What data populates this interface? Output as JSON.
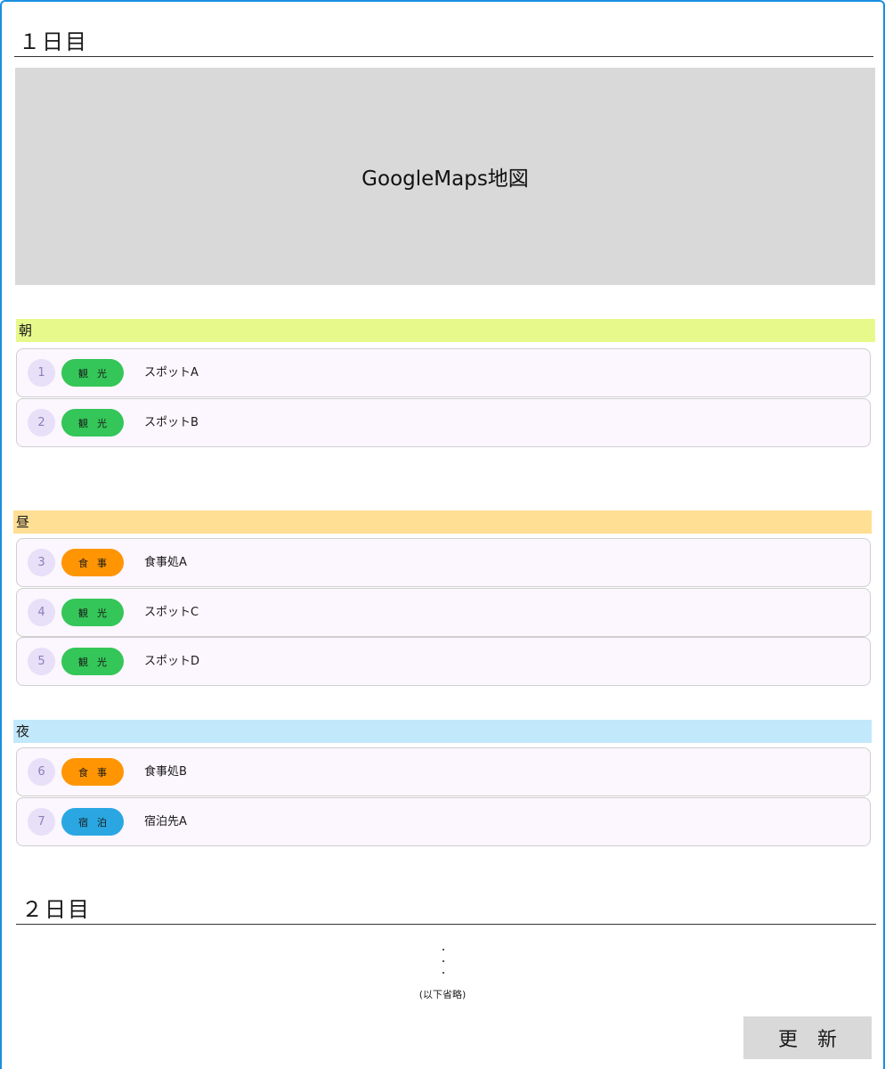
{
  "day1": {
    "title": "１日目"
  },
  "map": {
    "label": "GoogleMaps地図"
  },
  "periods": {
    "morning": {
      "label": "朝",
      "color": "#e8f98c"
    },
    "noon": {
      "label": "昼",
      "color": "#ffdf94"
    },
    "night": {
      "label": "夜",
      "color": "#c2e8fb"
    }
  },
  "categories": {
    "sightseeing": {
      "label": "観光",
      "color": "#34c658"
    },
    "meal": {
      "label": "食事",
      "color": "#ff9502"
    },
    "lodging": {
      "label": "宿泊",
      "color": "#2aa7e2"
    }
  },
  "items": [
    {
      "num": "1",
      "category": "観光",
      "name": "スポットA"
    },
    {
      "num": "2",
      "category": "観光",
      "name": "スポットB"
    },
    {
      "num": "3",
      "category": "食事",
      "name": "食事処A"
    },
    {
      "num": "4",
      "category": "観光",
      "name": "スポットC"
    },
    {
      "num": "5",
      "category": "観光",
      "name": "スポットD"
    },
    {
      "num": "6",
      "category": "食事",
      "name": "食事処B"
    },
    {
      "num": "7",
      "category": "宿泊",
      "name": "宿泊先A"
    }
  ],
  "day2": {
    "title": "２日目"
  },
  "omitted_text": "(以下省略)",
  "update_button": {
    "label": "更新"
  }
}
